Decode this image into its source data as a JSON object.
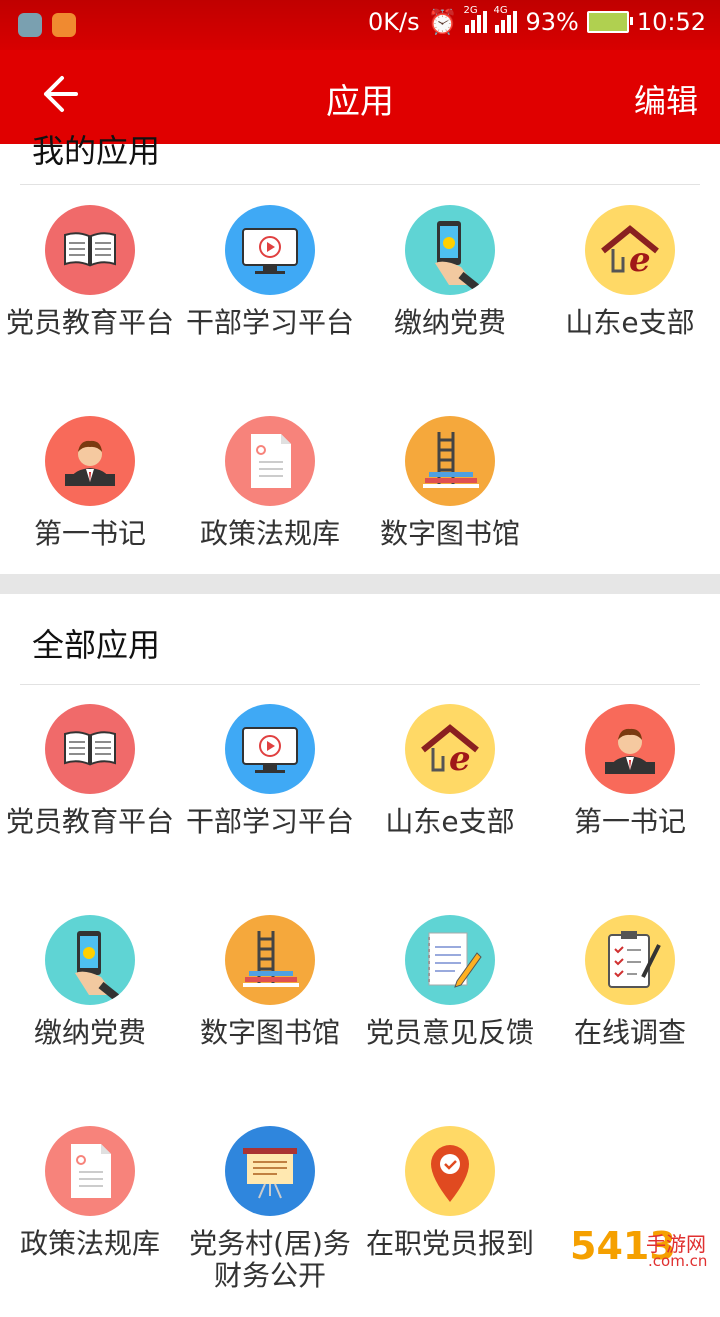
{
  "status_bar": {
    "net_speed": "0K/s",
    "sim1": "2G",
    "sim2": "4G",
    "battery": "93%",
    "time": "10:52"
  },
  "app_bar": {
    "title": "应用",
    "edit_label": "编辑"
  },
  "my_apps": {
    "title": "我的应用",
    "items": [
      {
        "label": "党员教育平台",
        "icon": "book-icon"
      },
      {
        "label": "干部学习平台",
        "icon": "monitor-play-icon"
      },
      {
        "label": "缴纳党费",
        "icon": "phone-payment-icon"
      },
      {
        "label": "山东e支部",
        "icon": "home-e-icon"
      },
      {
        "label": "第一书记",
        "icon": "person-icon"
      },
      {
        "label": "政策法规库",
        "icon": "document-icon"
      },
      {
        "label": "数字图书馆",
        "icon": "library-icon"
      }
    ]
  },
  "all_apps": {
    "title": "全部应用",
    "items": [
      {
        "label": "党员教育平台",
        "icon": "book-icon"
      },
      {
        "label": "干部学习平台",
        "icon": "monitor-play-icon"
      },
      {
        "label": "山东e支部",
        "icon": "home-e-icon"
      },
      {
        "label": "第一书记",
        "icon": "person-icon"
      },
      {
        "label": "缴纳党费",
        "icon": "phone-payment-icon"
      },
      {
        "label": "数字图书馆",
        "icon": "library-icon"
      },
      {
        "label": "党员意见反馈",
        "icon": "notebook-pen-icon"
      },
      {
        "label": "在线调查",
        "icon": "clipboard-icon"
      },
      {
        "label": "政策法规库",
        "icon": "document-icon"
      },
      {
        "label": "党务村(居)务财务公开",
        "icon": "presentation-board-icon"
      },
      {
        "label": "在职党员报到",
        "icon": "map-pin-icon"
      }
    ]
  },
  "watermark": {
    "brand": "5413",
    "text1": "手游网",
    "text2": ".com.cn"
  },
  "colors": {
    "header_red": "#e00000",
    "book": "#f06a6a",
    "monitor": "#3fa9f5",
    "phone": "#5fd4d4",
    "home": "#ffd966",
    "person": "#f86a5a",
    "document": "#f7837b",
    "library": "#f5a83c",
    "notebook": "#5fd4d4",
    "clipboard": "#ffd966",
    "presentation": "#2f86dd",
    "pin": "#ffd966"
  }
}
